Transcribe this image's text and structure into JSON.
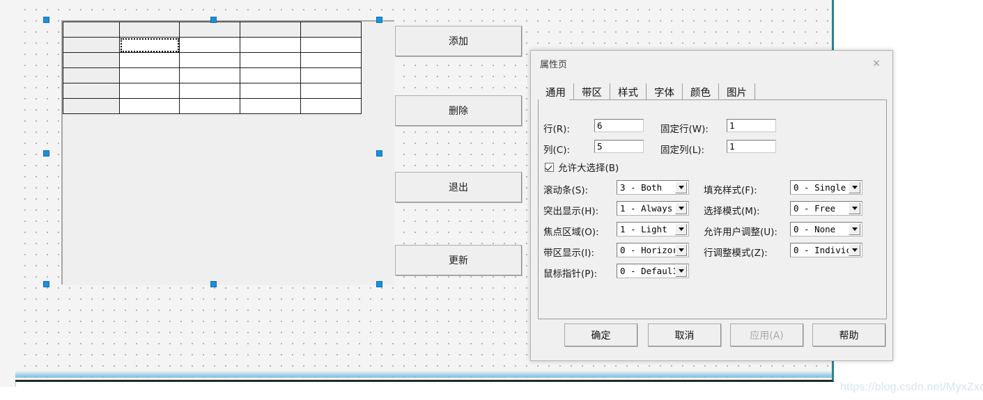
{
  "designer": {
    "grid": {
      "name": "MSFlexGrid",
      "rows": 6,
      "cols": 5,
      "fixed_rows": 1,
      "fixed_cols": 1,
      "focus_cell": {
        "row": 1,
        "col": 1
      },
      "cells": [
        [
          "",
          "",
          "",
          "",
          ""
        ],
        [
          "",
          "",
          "",
          "",
          ""
        ],
        [
          "",
          "",
          "",
          "",
          ""
        ],
        [
          "",
          "",
          "",
          "",
          ""
        ],
        [
          "",
          "",
          "",
          "",
          ""
        ],
        [
          "",
          "",
          "",
          "",
          ""
        ]
      ]
    },
    "buttons": [
      {
        "label": "添加",
        "name": "add-button"
      },
      {
        "label": "删除",
        "name": "delete-button"
      },
      {
        "label": "退出",
        "name": "exit-button"
      },
      {
        "label": "更新",
        "name": "update-button"
      }
    ]
  },
  "dialog": {
    "title": "属性页",
    "close_icon": "×",
    "tabs": [
      {
        "label": "通用",
        "active": true
      },
      {
        "label": "带区",
        "active": false
      },
      {
        "label": "样式",
        "active": false
      },
      {
        "label": "字体",
        "active": false
      },
      {
        "label": "颜色",
        "active": false
      },
      {
        "label": "图片",
        "active": false
      }
    ],
    "fields": {
      "rows_label": "行(R):",
      "rows_value": "6",
      "cols_label": "列(C):",
      "cols_value": "5",
      "fixed_rows_label": "固定行(W):",
      "fixed_rows_value": "1",
      "fixed_cols_label": "固定列(L):",
      "fixed_cols_value": "1",
      "allow_big_selection_label": "允许大选择(B)",
      "allow_big_selection_checked": true
    },
    "combos_left": [
      {
        "label": "滚动条(S):",
        "value": "3 - Both",
        "name": "scrollbars-combo"
      },
      {
        "label": "突出显示(H):",
        "value": "1 - Always",
        "name": "highlight-combo"
      },
      {
        "label": "焦点区域(O):",
        "value": "1 - Light",
        "name": "focus-rect-combo"
      },
      {
        "label": "带区显示(I):",
        "value": "0 - Horizor",
        "name": "band-display-combo"
      },
      {
        "label": "鼠标指针(P):",
        "value": "0 - Defaul1",
        "name": "mouse-pointer-combo"
      }
    ],
    "combos_right": [
      {
        "label": "填充样式(F):",
        "value": "0 - Single",
        "name": "fill-style-combo"
      },
      {
        "label": "选择模式(M):",
        "value": "0 - Free",
        "name": "select-mode-combo"
      },
      {
        "label": "允许用户调整(U):",
        "value": "0 - None",
        "name": "allow-user-resizing-combo"
      },
      {
        "label": "行调整模式(Z):",
        "value": "0 - Indivic",
        "name": "row-sizing-mode-combo"
      }
    ],
    "footer_buttons": [
      {
        "label": "确定",
        "name": "ok-button",
        "disabled": false
      },
      {
        "label": "取消",
        "name": "cancel-button",
        "disabled": false
      },
      {
        "label": "应用(A)",
        "name": "apply-button",
        "disabled": true
      },
      {
        "label": "帮助",
        "name": "help-button",
        "disabled": false
      }
    ]
  },
  "watermark": "https://blog.csdn.net/MyxZxd",
  "colors": {
    "accent": "#1a8fe0",
    "dialog_bg": "#f0f0f0",
    "designer_bg": "#f4f4f4",
    "designer_border": "#2f7f93"
  }
}
